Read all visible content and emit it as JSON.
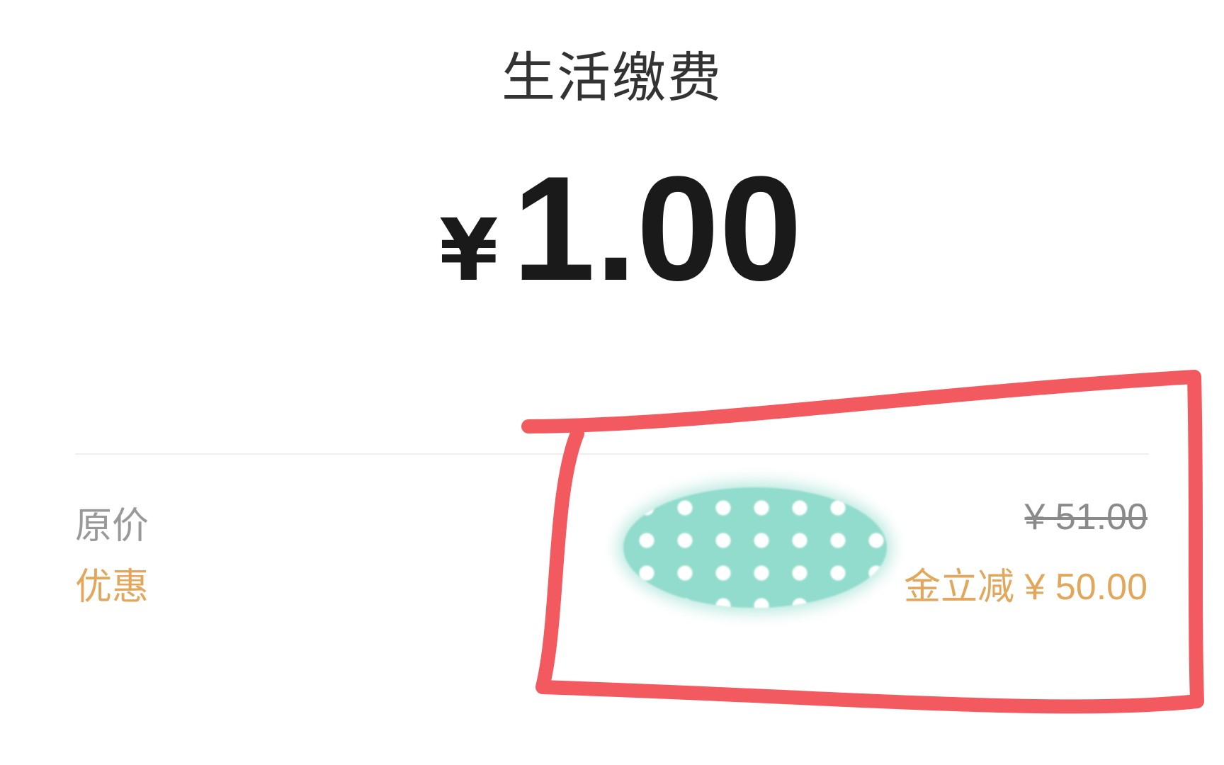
{
  "screen": {
    "title": "生活缴费",
    "amount": {
      "currency_symbol": "¥",
      "value": "1.00"
    }
  },
  "details": {
    "original_price_label": "原价",
    "original_price_value": "¥ 51.00",
    "discount_label": "优惠",
    "discount_value": "金立减 ¥ 50.00"
  },
  "colors": {
    "discount": "#e2a75a",
    "muted_text": "#999999",
    "annotation_stroke": "#f35a5f",
    "redaction_fill": "#92dccd"
  }
}
